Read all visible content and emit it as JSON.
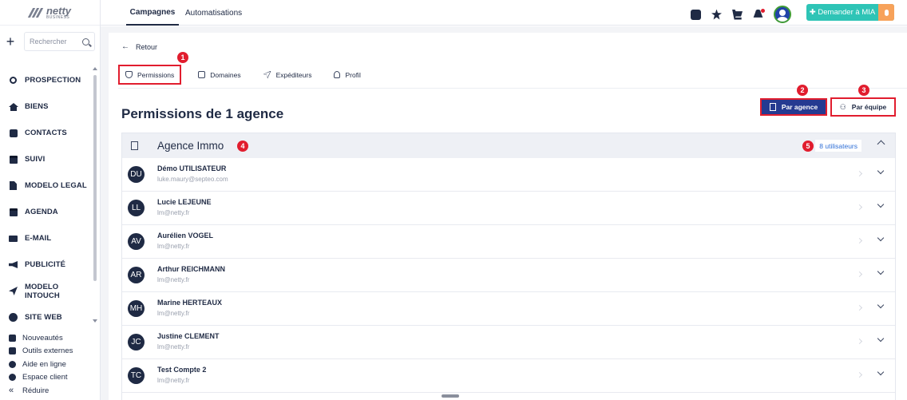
{
  "brand": {
    "name": "netty",
    "sub": "BUSINESS"
  },
  "search": {
    "placeholder": "Rechercher",
    "add_label": "+"
  },
  "sidebar": {
    "items": [
      {
        "label": "PROSPECTION",
        "icon": "search-icon"
      },
      {
        "label": "BIENS",
        "icon": "house-icon"
      },
      {
        "label": "CONTACTS",
        "icon": "contact-card-icon"
      },
      {
        "label": "SUIVI",
        "icon": "calendar-check-icon"
      },
      {
        "label": "MODELO LEGAL",
        "icon": "document-icon"
      },
      {
        "label": "AGENDA",
        "icon": "calendar-icon"
      },
      {
        "label": "E-MAIL",
        "icon": "mail-icon"
      },
      {
        "label": "PUBLICITÉ",
        "icon": "megaphone-icon"
      },
      {
        "label": "MODELO INTOUCH",
        "icon": "paper-plane-icon"
      },
      {
        "label": "SITE WEB",
        "icon": "globe-icon"
      }
    ],
    "bottom": [
      {
        "label": "Nouveautés",
        "icon": "news-icon"
      },
      {
        "label": "Outils externes",
        "icon": "car-icon"
      },
      {
        "label": "Aide en ligne",
        "icon": "info-icon"
      },
      {
        "label": "Espace client",
        "icon": "user-circle-icon"
      },
      {
        "label": "Réduire",
        "icon": "collapse-icon",
        "glyph": "«"
      }
    ]
  },
  "topbar": {
    "tabs": [
      "Campagnes",
      "Automatisations"
    ],
    "mia_label": "✚ Demander à MIA",
    "colors": {
      "mia": "#2ec4b6",
      "mic": "#f7a25a",
      "avatar_ring": "#3f9b35"
    }
  },
  "page": {
    "back_label": "Retour",
    "tabs": [
      "Permissions",
      "Domaines",
      "Expéditeurs",
      "Profil"
    ],
    "title": "Permissions de 1 agence",
    "btn_agence": "Par agence",
    "btn_equipe": "Par équipe"
  },
  "markers": [
    "1",
    "2",
    "3",
    "4",
    "5"
  ],
  "group": {
    "title": "Agence Immo",
    "count_label": "8 utilisateurs"
  },
  "users": [
    {
      "initials": "DU",
      "name": "Démo UTILISATEUR",
      "email": "luke.maury@septeo.com"
    },
    {
      "initials": "LL",
      "name": "Lucie LEJEUNE",
      "email": "lm@netty.fr"
    },
    {
      "initials": "AV",
      "name": "Aurélien VOGEL",
      "email": "lm@netty.fr"
    },
    {
      "initials": "AR",
      "name": "Arthur REICHMANN",
      "email": "lm@netty.fr"
    },
    {
      "initials": "MH",
      "name": "Marine HERTEAUX",
      "email": "lm@netty.fr"
    },
    {
      "initials": "JC",
      "name": "Justine CLEMENT",
      "email": "lm@netty.fr"
    },
    {
      "initials": "TC",
      "name": "Test Compte 2",
      "email": "lm@netty.fr"
    }
  ],
  "colors": {
    "accent": "#253a91",
    "highlight": "#e11d2e",
    "link": "#2f6fd6"
  }
}
